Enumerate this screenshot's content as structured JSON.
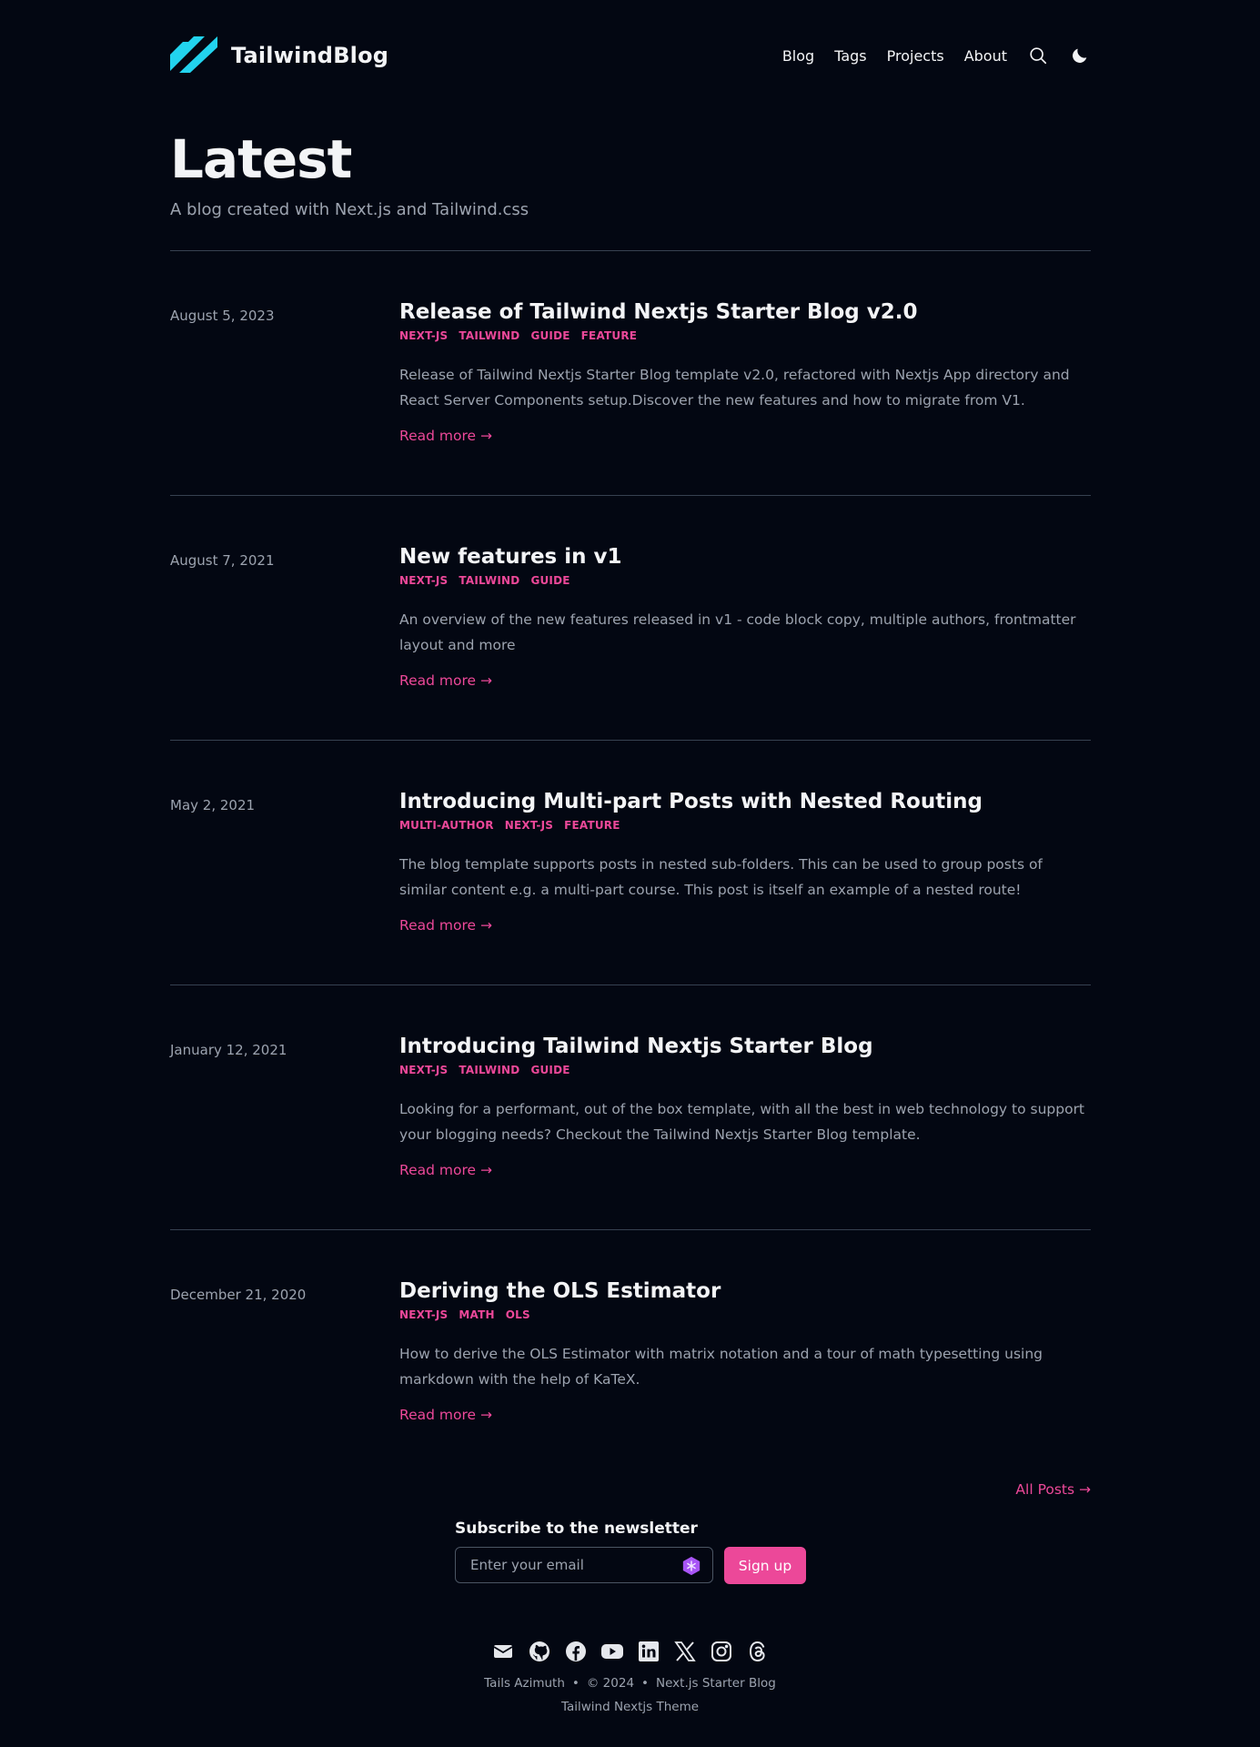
{
  "header": {
    "brand": "TailwindBlog",
    "nav": [
      "Blog",
      "Tags",
      "Projects",
      "About"
    ],
    "icons": [
      "search-icon",
      "moon-icon"
    ]
  },
  "hero": {
    "title": "Latest",
    "subtitle": "A blog created with Next.js and Tailwind.css"
  },
  "posts": [
    {
      "date": "August 5, 2023",
      "title": "Release of Tailwind Nextjs Starter Blog v2.0",
      "tags": [
        "NEXT-JS",
        "TAILWIND",
        "GUIDE",
        "FEATURE"
      ],
      "summary": "Release of Tailwind Nextjs Starter Blog template v2.0, refactored with Nextjs App directory and React Server Components setup.Discover the new features and how to migrate from V1.",
      "read_more": "Read more →"
    },
    {
      "date": "August 7, 2021",
      "title": "New features in v1",
      "tags": [
        "NEXT-JS",
        "TAILWIND",
        "GUIDE"
      ],
      "summary": "An overview of the new features released in v1 - code block copy, multiple authors, frontmatter layout and more",
      "read_more": "Read more →"
    },
    {
      "date": "May 2, 2021",
      "title": "Introducing Multi-part Posts with Nested Routing",
      "tags": [
        "MULTI-AUTHOR",
        "NEXT-JS",
        "FEATURE"
      ],
      "summary": "The blog template supports posts in nested sub-folders. This can be used to group posts of similar content e.g. a multi-part course. This post is itself an example of a nested route!",
      "read_more": "Read more →"
    },
    {
      "date": "January 12, 2021",
      "title": "Introducing Tailwind Nextjs Starter Blog",
      "tags": [
        "NEXT-JS",
        "TAILWIND",
        "GUIDE"
      ],
      "summary": "Looking for a performant, out of the box template, with all the best in web technology to support your blogging needs? Checkout the Tailwind Nextjs Starter Blog template.",
      "read_more": "Read more →"
    },
    {
      "date": "December 21, 2020",
      "title": "Deriving the OLS Estimator",
      "tags": [
        "NEXT-JS",
        "MATH",
        "OLS"
      ],
      "summary": "How to derive the OLS Estimator with matrix notation and a tour of math typesetting using markdown with the help of KaTeX.",
      "read_more": "Read more →"
    }
  ],
  "all_posts": "All Posts →",
  "newsletter": {
    "title": "Subscribe to the newsletter",
    "placeholder": "Enter your email",
    "button": "Sign up"
  },
  "footer": {
    "social_icons": [
      "mail-icon",
      "github-icon",
      "facebook-icon",
      "youtube-icon",
      "linkedin-icon",
      "x-icon",
      "instagram-icon",
      "threads-icon"
    ],
    "author": "Tails Azimuth",
    "separator": "•",
    "copyright": "© 2024",
    "site": "Next.js Starter Blog",
    "theme": "Tailwind Nextjs Theme"
  },
  "colors": {
    "background": "#030712",
    "accent": "#ec4899",
    "logo": "#22d3ee"
  }
}
